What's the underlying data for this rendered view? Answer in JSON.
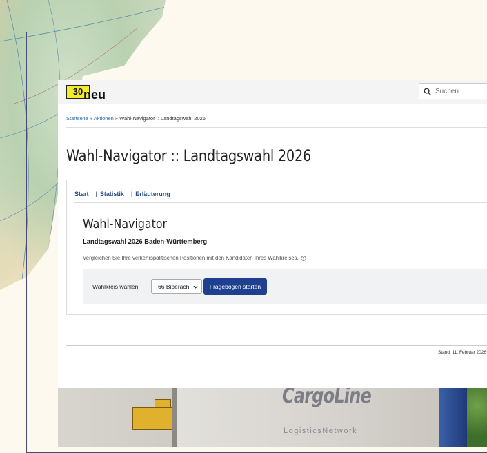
{
  "header": {
    "logo_number": "30",
    "logo_text": "neu",
    "search_placeholder": "Suchen"
  },
  "breadcrumb": {
    "items": [
      "Startseite",
      "Aktionen"
    ],
    "current": "Wahl-Navigator :: Landtagswahl 2026",
    "separator": "»"
  },
  "page_title": "Wahl-Navigator :: Landtagswahl 2026",
  "tabs": [
    {
      "label": "Start"
    },
    {
      "label": "Statistik"
    },
    {
      "label": "Erläuterung"
    }
  ],
  "tab_separator": "|",
  "navigator": {
    "title": "Wahl-Navigator",
    "subtitle": "Landtagswahl 2026 Baden-Württemberg",
    "description": "Vergleichen Sie Ihre verkehrspolitischen Positionen mit den Kandidaten Ihres Wahlkreises."
  },
  "form": {
    "label": "Wahlkreis wählen:",
    "selected": "66 Biberach",
    "button": "Fragebogen starten"
  },
  "footer": {
    "stand": "Stand: 11. Februar 2026"
  },
  "photo": {
    "brand": "CargoLine",
    "brand_sub": "LogisticsNetwork"
  },
  "colors": {
    "logo_yellow": "#f2ea2a",
    "link_blue": "#2a6bb0",
    "tab_blue": "#2c4f8a",
    "button_blue": "#1f3f8f",
    "page_bg": "#fdf9ef"
  }
}
